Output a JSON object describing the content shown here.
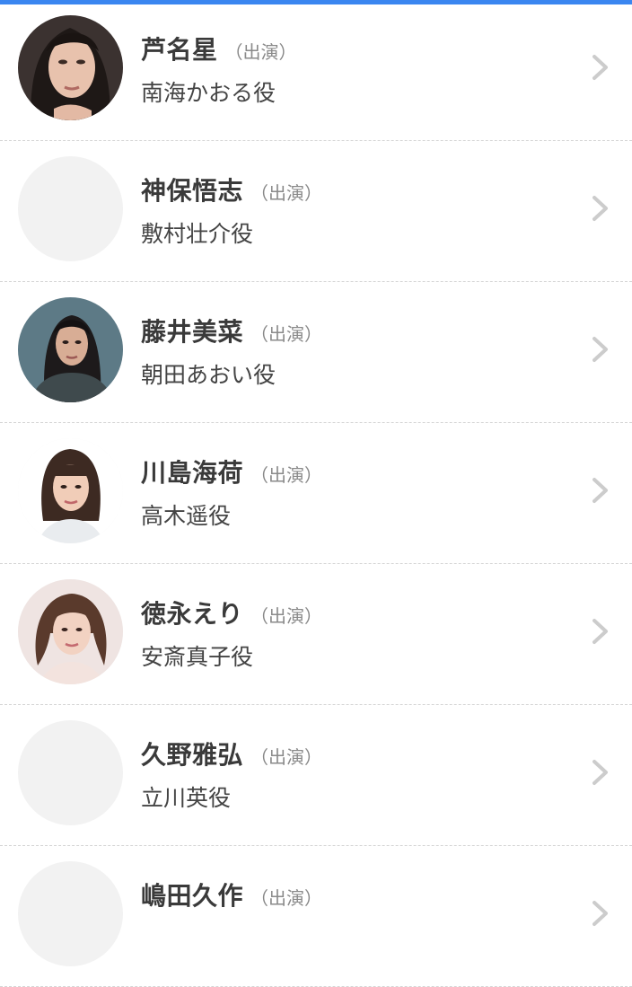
{
  "cast": [
    {
      "name": "芦名星",
      "credit": "（出演）",
      "role": "南海かおる役",
      "avatar": "portrait-woman-dark-hair"
    },
    {
      "name": "神保悟志",
      "credit": "（出演）",
      "role": "敷村壮介役",
      "avatar": "placeholder"
    },
    {
      "name": "藤井美菜",
      "credit": "（出演）",
      "role": "朝田あおい役",
      "avatar": "portrait-woman-dark-background"
    },
    {
      "name": "川島海荷",
      "credit": "（出演）",
      "role": "高木遥役",
      "avatar": "portrait-woman-bob-hair"
    },
    {
      "name": "徳永えり",
      "credit": "（出演）",
      "role": "安斎真子役",
      "avatar": "portrait-woman-wavy-hair"
    },
    {
      "name": "久野雅弘",
      "credit": "（出演）",
      "role": "立川英役",
      "avatar": "placeholder"
    },
    {
      "name": "嶋田久作",
      "credit": "（出演）",
      "role": "",
      "avatar": "placeholder"
    }
  ],
  "colors": {
    "accent": "#3a86f0",
    "name": "#3a3a3a",
    "credit": "#8a8a8a",
    "chevron": "#cccccc",
    "placeholder": "#f2f2f2"
  }
}
